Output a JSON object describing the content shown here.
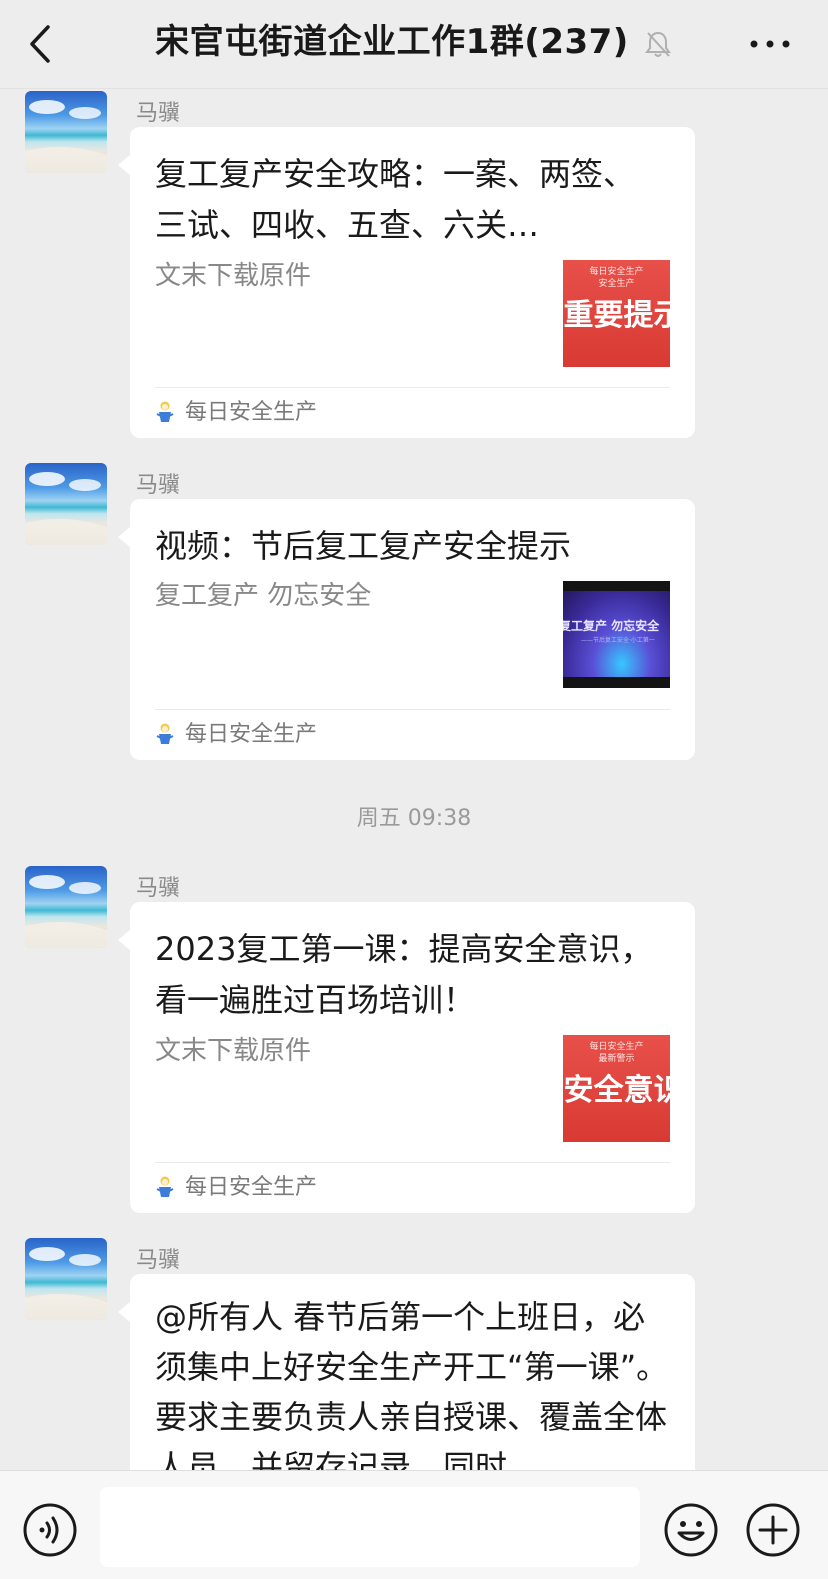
{
  "header": {
    "title": "宋官屯街道企业工作1群(237)",
    "back_icon": "chevron-left-icon",
    "mute_icon": "bell-off-icon",
    "more_icon": "ellipsis-icon"
  },
  "messages": [
    {
      "sender": "马骥",
      "type": "article",
      "title": "复工复产安全攻略：一案、两签、三试、四收、五查、六关…",
      "description": "文末下载原件",
      "thumbnail": {
        "small_lines": [
          "每日安全生产",
          "安全生产"
        ],
        "big_text": "重要提示"
      },
      "source": "每日安全生产"
    },
    {
      "sender": "马骥",
      "type": "video",
      "title": "视频：节后复工复产安全提示",
      "description": "复工复产 勿忘安全",
      "thumbnail": {
        "big_text": "复工复产 勿忘安全",
        "sub_text": "——节后复工安全·小工第一"
      },
      "source": "每日安全生产"
    },
    {
      "sender": "马骥",
      "type": "article",
      "title": "2023复工第一课：提高安全意识，看一遍胜过百场培训！",
      "description": "文末下载原件",
      "thumbnail": {
        "small_lines": [
          "每日安全生产",
          "最新警示"
        ],
        "big_text": "安全意识"
      },
      "source": "每日安全生产"
    },
    {
      "sender": "马骥",
      "type": "text",
      "text": "@所有人  春节后第一个上班日，必须集中上好安全生产开工“第一课”。要求主要负责人亲自授课、覆盖全体人员，并留存记录，同时"
    }
  ],
  "timestamp": "周五 09:38",
  "input_bar": {
    "placeholder": "",
    "voice_icon": "voice-icon",
    "emoji_icon": "emoji-icon",
    "plus_icon": "plus-circle-icon"
  }
}
